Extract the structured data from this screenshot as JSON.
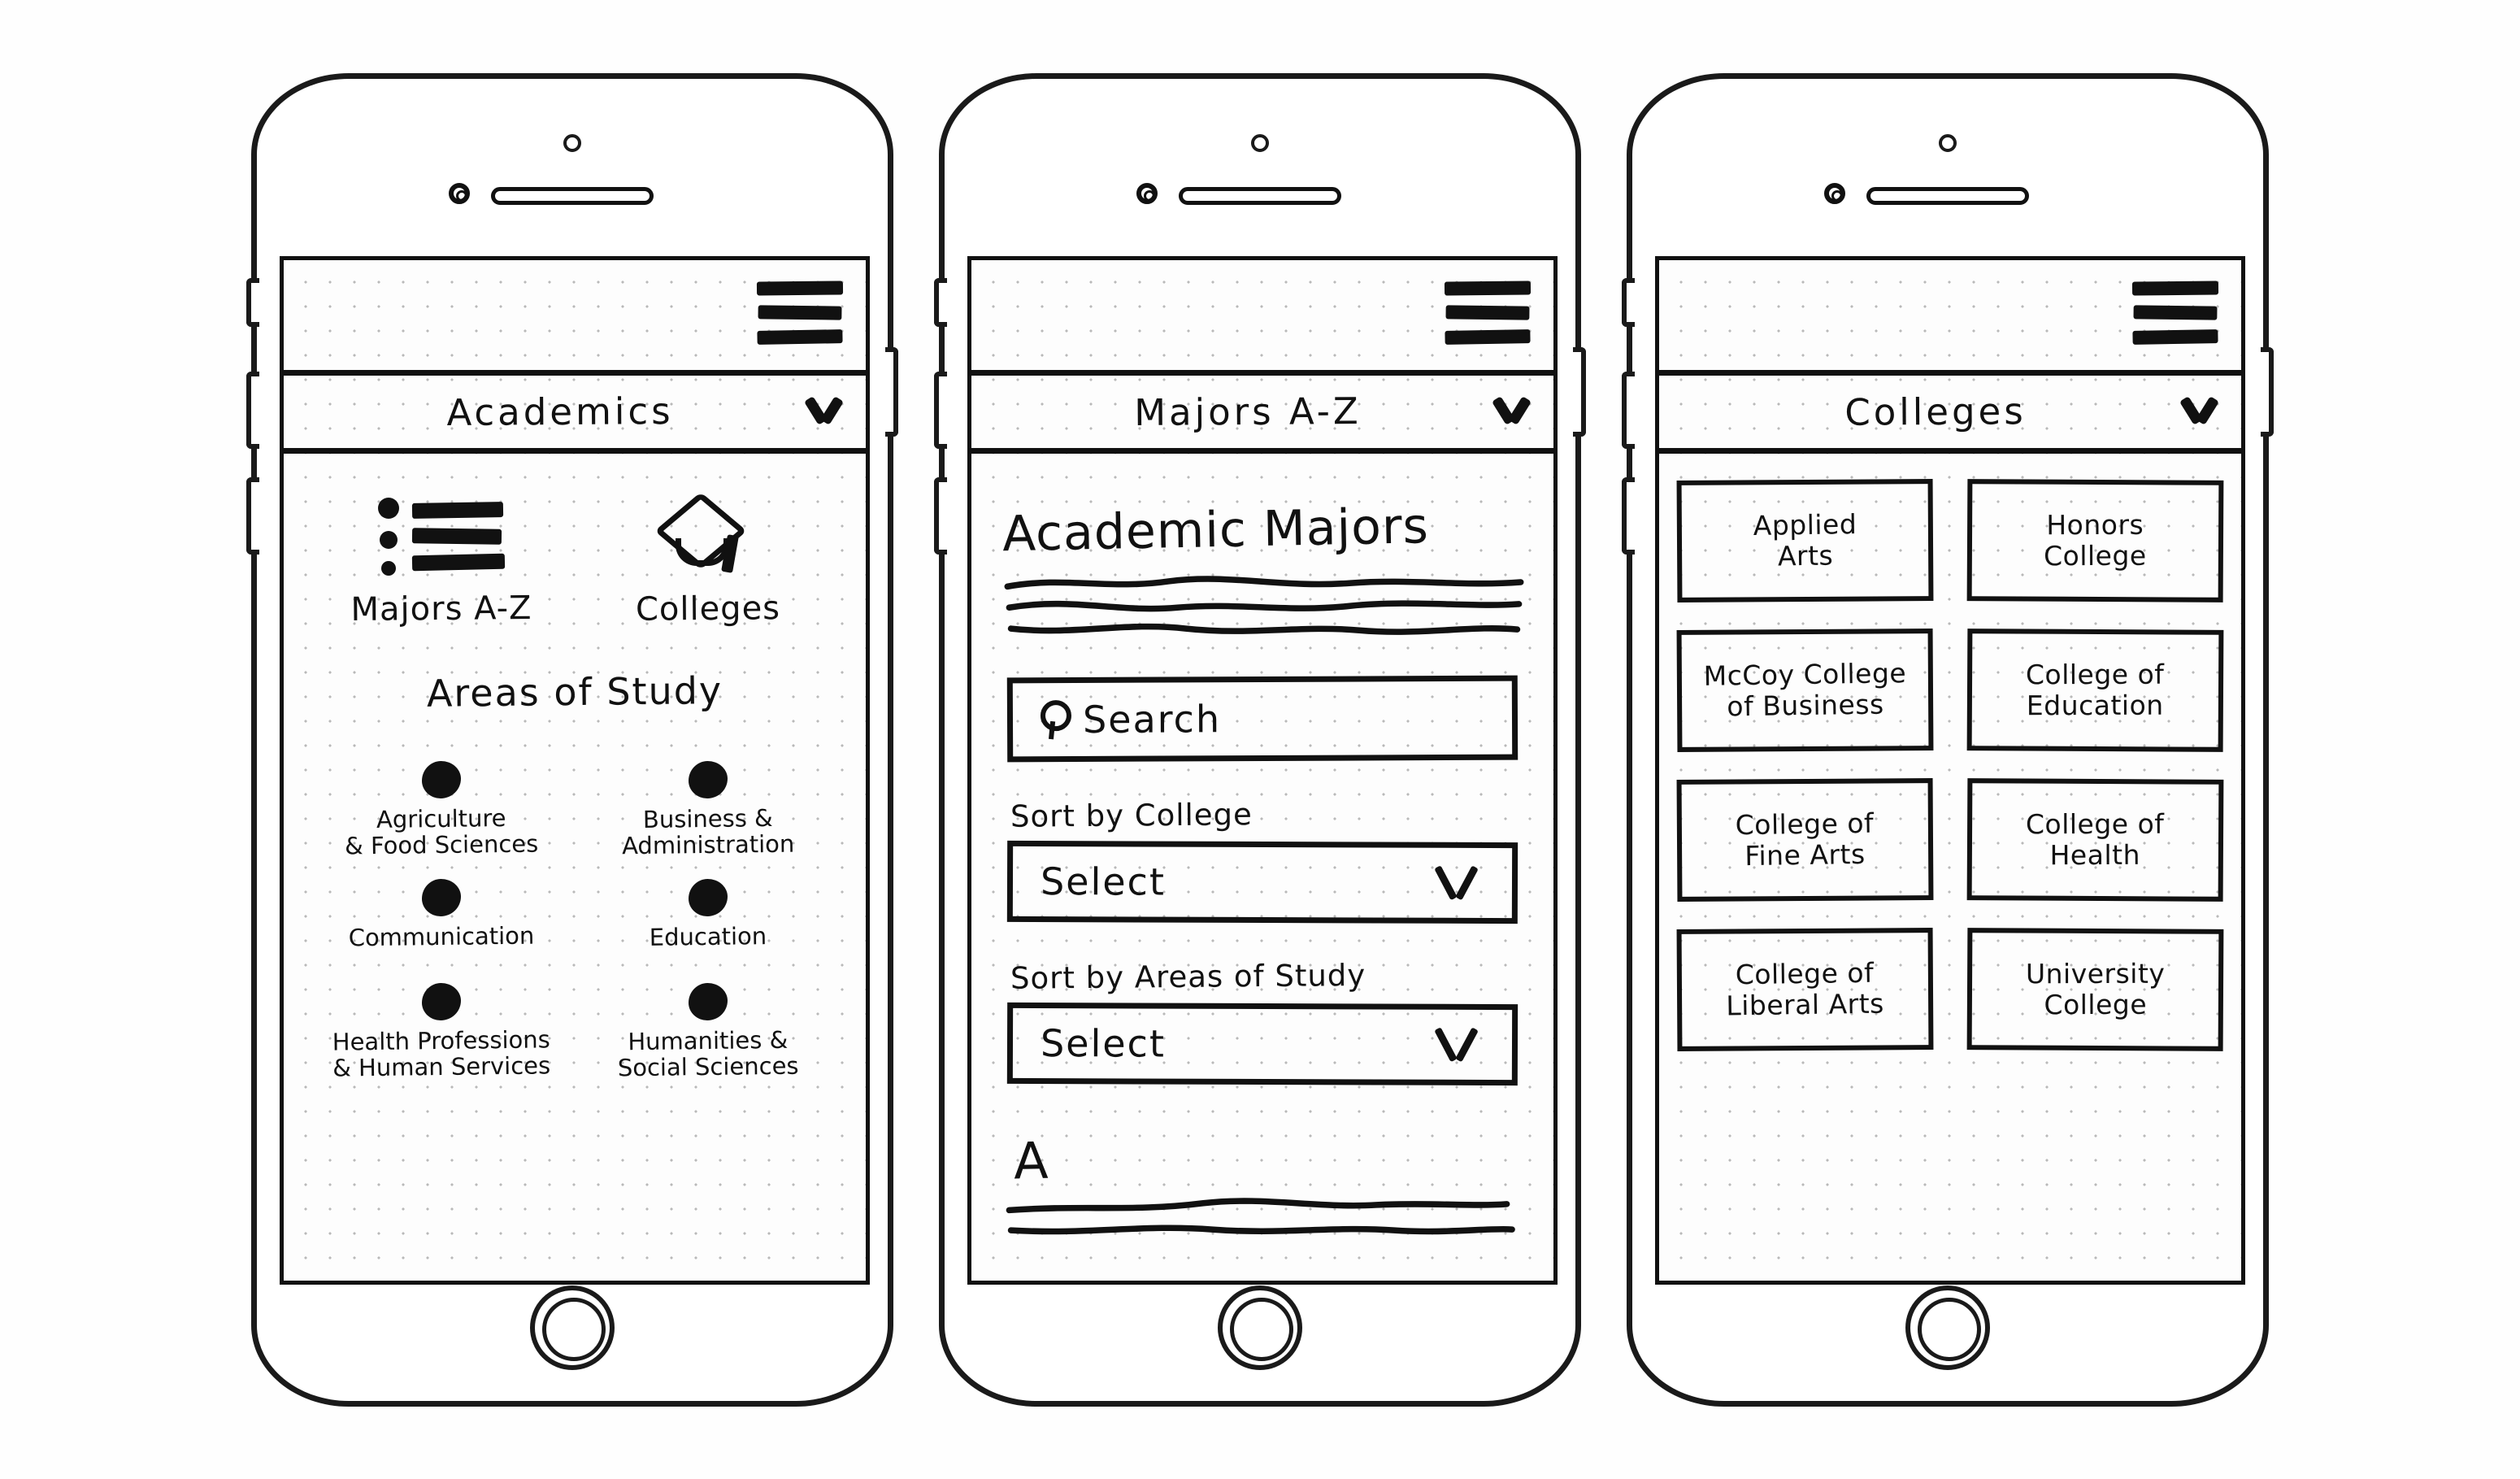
{
  "screens": [
    {
      "id": "academics",
      "menu_icon": "hamburger-menu-icon",
      "title": "Academics",
      "title_chevron": "chevron-down-icon",
      "quick_links": [
        {
          "icon": "list-icon",
          "label": "Majors A-Z"
        },
        {
          "icon": "graduation-cap-icon",
          "label": "Colleges"
        }
      ],
      "section_title": "Areas of Study",
      "areas": [
        {
          "icon": "circle-icon",
          "label": "Agriculture\n& Food Sciences"
        },
        {
          "icon": "circle-icon",
          "label": "Business &\nAdministration"
        },
        {
          "icon": "circle-icon",
          "label": "Communication"
        },
        {
          "icon": "circle-icon",
          "label": "Education"
        },
        {
          "icon": "circle-icon",
          "label": "Health Professions\n& Human Services"
        },
        {
          "icon": "circle-icon",
          "label": "Humanities &\nSocial Sciences"
        }
      ]
    },
    {
      "id": "majors-a-z",
      "menu_icon": "hamburger-menu-icon",
      "title": "Majors  A-Z",
      "title_chevron": "chevron-down-icon",
      "heading": "Academic Majors",
      "body_placeholder_lines": 3,
      "search": {
        "icon": "search-icon",
        "value": "Search"
      },
      "sort_by_college": {
        "label": "Sort by College",
        "value": "Select",
        "chevron": "chevron-down-icon"
      },
      "sort_by_areas": {
        "label": "Sort by Areas of Study",
        "value": "Select",
        "chevron": "chevron-down-icon"
      },
      "letter_index": "A",
      "letter_placeholder_lines": 2
    },
    {
      "id": "colleges",
      "menu_icon": "hamburger-menu-icon",
      "title": "Colleges",
      "title_chevron": "chevron-down-icon",
      "tiles": [
        "Applied\nArts",
        "Honors\nCollege",
        "McCoy College\nof Business",
        "College of\nEducation",
        "College of\nFine Arts",
        "College of\nHealth",
        "College of\nLiberal Arts",
        "University\nCollege"
      ]
    }
  ],
  "colors": {
    "ink": "#111111",
    "paper": "#fdfdfd",
    "grid_dot": "#b9b9b9"
  }
}
